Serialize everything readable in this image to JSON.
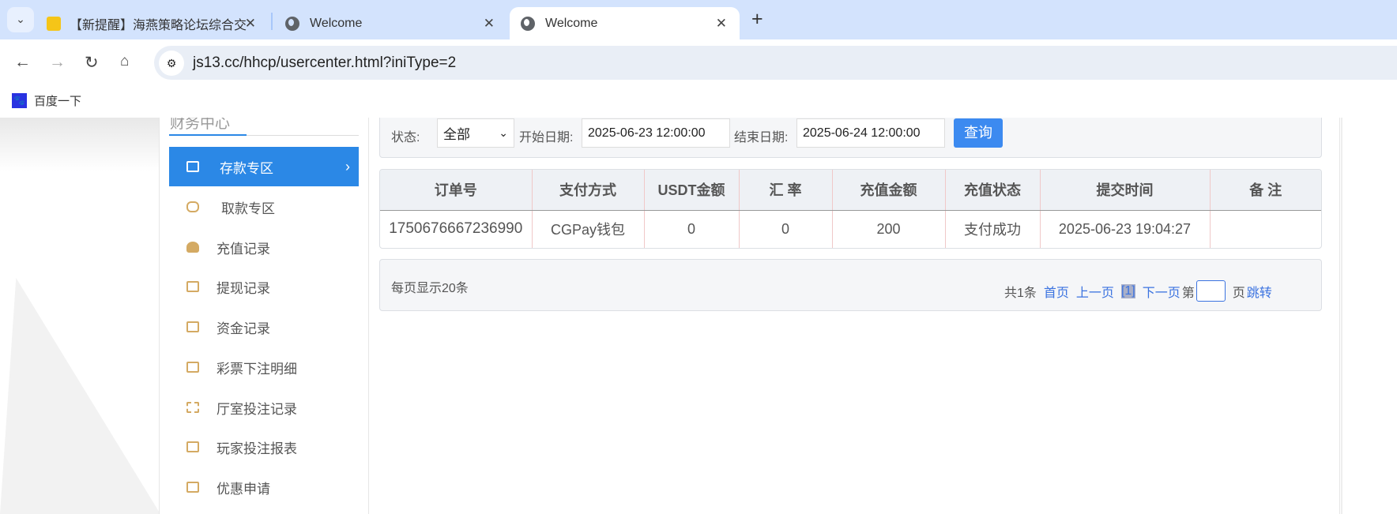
{
  "browser": {
    "tabs": [
      {
        "title": "【新提醒】海燕策略论坛综合交",
        "icon": "forum-favicon"
      },
      {
        "title": "Welcome",
        "icon": "globe-icon"
      },
      {
        "title": "Welcome",
        "icon": "globe-icon",
        "active": true
      }
    ],
    "url": "js13.cc/hhcp/usercenter.html?iniType=2",
    "bookmarks": [
      {
        "label": "百度一下",
        "icon": "baidu-paw-icon"
      }
    ]
  },
  "sidebar": {
    "title": "财务中心",
    "items": [
      {
        "label": "存款专区",
        "icon": "card-icon",
        "active": true
      },
      {
        "label": "取款专区",
        "icon": "hand-money-icon"
      },
      {
        "label": "充值记录",
        "icon": "money-bag-icon"
      },
      {
        "label": "提现记录",
        "icon": "wallet-icon"
      },
      {
        "label": "资金记录",
        "icon": "cash-icon"
      },
      {
        "label": "彩票下注明细",
        "icon": "list-card-icon"
      },
      {
        "label": "厅室投注记录",
        "icon": "list-icon"
      },
      {
        "label": "玩家投注报表",
        "icon": "chart-icon"
      },
      {
        "label": "优惠申请",
        "icon": "coupon-icon"
      }
    ]
  },
  "filter": {
    "status_label": "状态:",
    "status_value": "全部",
    "start_label": "开始日期:",
    "start_value": "2025-06-23 12:00:00",
    "end_label": "结束日期:",
    "end_value": "2025-06-24 12:00:00",
    "query_button": "查询"
  },
  "table": {
    "headers": [
      "订单号",
      "支付方式",
      "USDT金额",
      "汇 率",
      "充值金额",
      "充值状态",
      "提交时间",
      "备 注"
    ],
    "rows": [
      [
        "1750676667236990",
        "CGPay钱包",
        "0",
        "0",
        "200",
        "支付成功",
        "2025-06-23 19:04:27",
        ""
      ]
    ]
  },
  "pager": {
    "per_page": "每页显示20条",
    "total": "共1条",
    "first": "首页",
    "prev": "上一页",
    "current": "[1]",
    "next": "下一页",
    "page_prefix": "第",
    "page_input": "",
    "page_suffix": "页",
    "jump": "跳转"
  },
  "colors": {
    "accent": "#2b88e6",
    "button": "#3c8af0",
    "link": "#3b73e0"
  }
}
